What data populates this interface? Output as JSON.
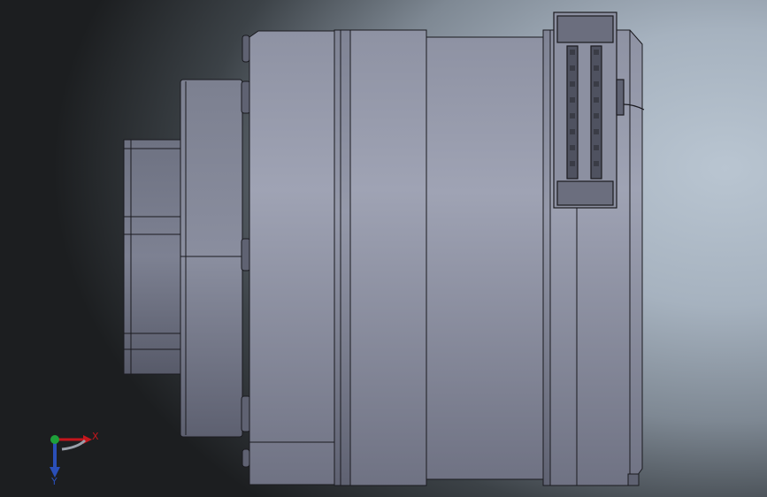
{
  "viewport": {
    "view_type": "3D CAD model viewport (side view)",
    "background_gradient": [
      "#b9c5d1",
      "#7e8893",
      "#1c1e20"
    ],
    "model_fill_light": "#9da1b2",
    "model_fill_dark": "#6d7081",
    "edge_color": "#1a1a1f"
  },
  "triad": {
    "x_label": "X",
    "y_label": "Y",
    "x_color": "#c4161c",
    "y_color": "#2a4fb8",
    "z_color": "#1ea03a"
  }
}
